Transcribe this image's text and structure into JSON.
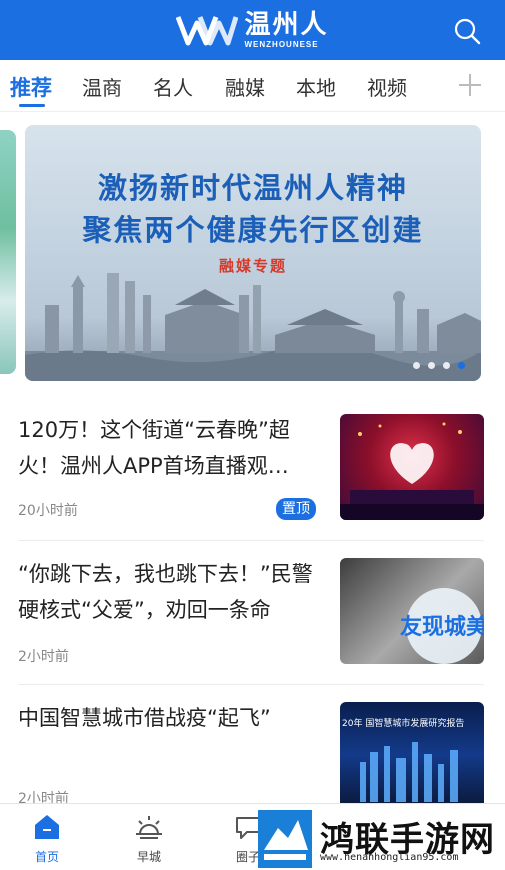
{
  "header": {
    "logo_cn": "温州人",
    "logo_en": "WENZHOUNESE",
    "brand_color": "#1b6fe0",
    "search_icon": "search-icon"
  },
  "tabs": [
    {
      "label": "推荐",
      "active": true
    },
    {
      "label": "温商",
      "active": false
    },
    {
      "label": "名人",
      "active": false
    },
    {
      "label": "融媒",
      "active": false
    },
    {
      "label": "本地",
      "active": false
    },
    {
      "label": "视频",
      "active": false
    }
  ],
  "tab_add_icon": "plus-icon",
  "banner": {
    "line1": "激扬新时代温州人精神",
    "line2": "聚焦两个健康先行区创建",
    "tag": "融媒专题",
    "page_count": 4,
    "active_page": 4
  },
  "news": [
    {
      "title": "120万！这个街道“云春晚”超火！温州人APP首场直播观…",
      "time": "20小时前",
      "badge": "置顶"
    },
    {
      "title": "“你跳下去，我也跳下去！”民警硬核式“父爱”，劝回一条命",
      "time": "2小时前",
      "thumb_text": "友现城美"
    },
    {
      "title": "中国智慧城市借战疫“起飞”",
      "time": "2小时前",
      "thumb_text": "20年 国智慧城市发展研究报告"
    }
  ],
  "bottom_nav": [
    {
      "label": "首页",
      "icon": "home-icon",
      "active": true
    },
    {
      "label": "早城",
      "icon": "sunrise-icon",
      "active": false
    },
    {
      "label": "圈子",
      "icon": "chat-bubble-icon",
      "active": false
    }
  ],
  "watermark": {
    "title": "鸿联手游网",
    "url": "www.henanhonglian95.com"
  }
}
